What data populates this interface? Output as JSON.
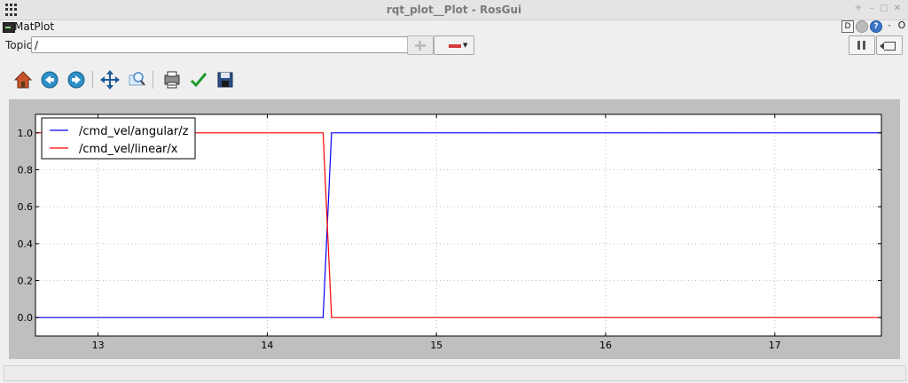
{
  "window": {
    "title": "rqt_plot__Plot - RosGui",
    "controls": [
      "☀",
      "–",
      "□",
      "✕"
    ]
  },
  "plugin": {
    "title": "MatPlot",
    "buttons": {
      "d": "D",
      "help": "?",
      "dash": "-",
      "close": "O"
    }
  },
  "topic": {
    "label": "Topic",
    "value": "/"
  },
  "toolbar": {
    "icons": [
      "home-icon",
      "back-icon",
      "forward-icon",
      "pan-icon",
      "zoom-icon",
      "subplots-icon",
      "edit-axes-icon",
      "save-icon"
    ]
  },
  "colors": {
    "angular": "#0000ff",
    "linear": "#ff0000",
    "plot_bg": "#bfbfbf",
    "axes_bg": "#ffffff"
  },
  "chart_data": {
    "type": "line",
    "xlim": [
      12.63,
      17.63
    ],
    "ylim": [
      -0.1,
      1.1
    ],
    "xticks": [
      13,
      14,
      15,
      16,
      17
    ],
    "xtick_labels": [
      "13",
      "14",
      "15",
      "16",
      "17"
    ],
    "yticks": [
      0.0,
      0.2,
      0.4,
      0.6,
      0.8,
      1.0
    ],
    "ytick_labels": [
      "0.0",
      "0.2",
      "0.4",
      "0.6",
      "0.8",
      "1.0"
    ],
    "grid": true,
    "legend_position": "top-left",
    "series": [
      {
        "name": "/cmd_vel/angular/z",
        "color": "#0000ff",
        "x": [
          12.63,
          14.33,
          14.38,
          17.63
        ],
        "y": [
          0.0,
          0.0,
          1.0,
          1.0
        ]
      },
      {
        "name": "/cmd_vel/linear/x",
        "color": "#ff0000",
        "x": [
          12.63,
          14.33,
          14.38,
          17.63
        ],
        "y": [
          1.0,
          1.0,
          0.0,
          0.0
        ]
      }
    ]
  }
}
